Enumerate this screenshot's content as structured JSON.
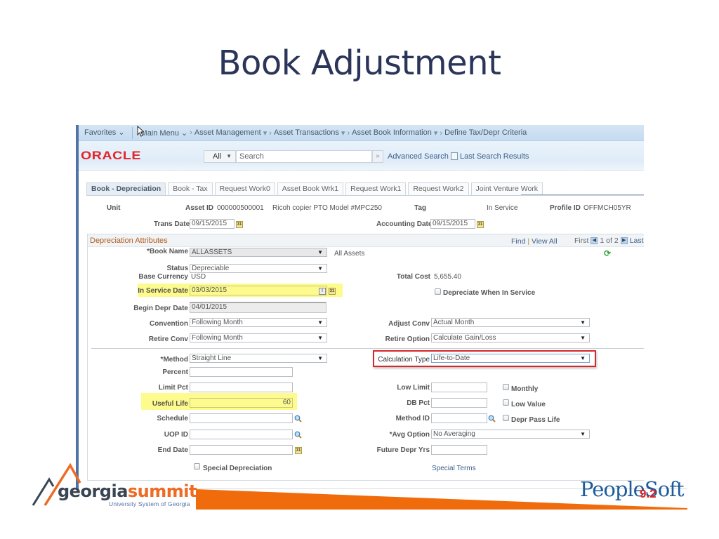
{
  "slide": {
    "title": "Book Adjustment"
  },
  "menubar": {
    "favorites": "Favorites",
    "main_menu": "Main Menu",
    "breadcrumb": [
      "Asset Management",
      "Asset Transactions",
      "Asset Book Information",
      "Define Tax/Depr Criteria"
    ]
  },
  "brandbar": {
    "logo": "ORACLE",
    "search_scope": "All",
    "search_placeholder": "Search",
    "search_go": "»",
    "advanced_search": "Advanced Search",
    "last_search_results": "Last Search Results"
  },
  "tabs": [
    {
      "label": "Book - Depreciation",
      "active": true
    },
    {
      "label": "Book - Tax",
      "active": false
    },
    {
      "label": "Request Work0",
      "active": false
    },
    {
      "label": "Asset Book Wrk1",
      "active": false
    },
    {
      "label": "Request Work1",
      "active": false
    },
    {
      "label": "Request Work2",
      "active": false
    },
    {
      "label": "Joint Venture Work",
      "active": false
    }
  ],
  "header": {
    "unit_label": "Unit",
    "asset_id_label": "Asset ID",
    "asset_id": "000000500001",
    "asset_desc": "Ricoh copier PTO Model #MPC250",
    "tag_label": "Tag",
    "status_text": "In Service",
    "profile_id_label": "Profile ID",
    "profile_id": "OFFMCH05YR",
    "trans_date_label": "Trans Date",
    "trans_date": "09/15/2015",
    "accounting_date_label": "Accounting Date",
    "accounting_date": "09/15/2015"
  },
  "section": {
    "title": "Depreciation Attributes",
    "find": "Find",
    "view_all": "View All",
    "first": "First",
    "page_info": "1 of 2",
    "last": "Last"
  },
  "fields": {
    "book_name_label": "*Book Name",
    "book_name": "ALLASSETS",
    "book_name_desc": "All Assets",
    "status_label": "Status",
    "status": "Depreciable",
    "base_currency_label": "Base Currency",
    "base_currency": "USD",
    "total_cost_label": "Total Cost",
    "total_cost": "5,655.40",
    "in_service_date_label": "In Service Date",
    "in_service_date": "03/03/2015",
    "depr_when_in_service_label": "Depreciate When In Service",
    "begin_depr_date_label": "Begin Depr Date",
    "begin_depr_date": "04/01/2015",
    "convention_label": "Convention",
    "convention": "Following Month",
    "adjust_conv_label": "Adjust Conv",
    "adjust_conv": "Actual Month",
    "retire_conv_label": "Retire Conv",
    "retire_conv": "Following Month",
    "retire_option_label": "Retire Option",
    "retire_option": "Calculate Gain/Loss",
    "method_label": "*Method",
    "method": "Straight Line",
    "calc_type_label": "Calculation Type",
    "calc_type": "Life-to-Date",
    "percent_label": "Percent",
    "percent": "",
    "limit_pct_label": "Limit Pct",
    "limit_pct": "",
    "low_limit_label": "Low Limit",
    "low_limit": "",
    "monthly_label": "Monthly",
    "useful_life_label": "Useful Life",
    "useful_life": "60",
    "db_pct_label": "DB Pct",
    "db_pct": "",
    "low_value_label": "Low Value",
    "schedule_label": "Schedule",
    "schedule": "",
    "method_id_label": "Method ID",
    "method_id": "",
    "depr_pass_life_label": "Depr Pass Life",
    "uop_id_label": "UOP ID",
    "uop_id": "",
    "avg_option_label": "*Avg Option",
    "avg_option": "No Averaging",
    "end_date_label": "End Date",
    "end_date": "",
    "future_depr_yrs_label": "Future Depr Yrs",
    "future_depr_yrs": "",
    "special_depr_label": "Special Depreciation",
    "special_terms": "Special Terms"
  },
  "footer": {
    "brand_left_a": "georgia",
    "brand_left_b": "summit",
    "brand_left_sub": "University System of Georgia",
    "brand_right": "PeopleSoft",
    "brand_right_version": "9.2",
    "colors": {
      "orange": "#f06b0c",
      "navy": "#3a4554",
      "peoplesoft_blue": "#1d5b9b",
      "version_red": "#e02020"
    }
  },
  "colors": {
    "highlight": "#fdfb8d",
    "callout_red": "#d9262c",
    "section_title": "#b35a16",
    "link": "#3d5f8a",
    "oracle_red": "#e2242b"
  }
}
